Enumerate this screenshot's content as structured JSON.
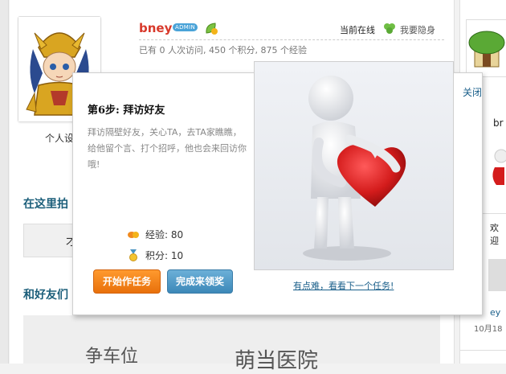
{
  "profile": {
    "username": "bney",
    "badge": "ADMIN",
    "avatar_label": "个人设",
    "online_label": "当前在线",
    "hide_link": "我要隐身",
    "stats": "已有 0 人次访问, 450 个积分, 875 个经验"
  },
  "sections": {
    "section1_title": "在这里拍",
    "section1_box_text": "才",
    "section2_title": "和好友们",
    "big_text_1": "争车位",
    "big_text_2": "萌当医院"
  },
  "right_panel": {
    "close": "关闭",
    "br_text": "br",
    "huan_text": "欢迎",
    "ey_text": "ey",
    "date_text": "10月18"
  },
  "popup": {
    "title": "第6步: 拜访好友",
    "description": "拜访隔壁好友，关心TA，去TA家瞧瞧，给他留个言、打个招呼，他也会来回访你哦!",
    "exp_label": "经验: 80",
    "points_label": "积分: 10",
    "start_button": "开始作任务",
    "finish_button": "完成来领奖",
    "close_link": "关闭",
    "next_link": "有点难，看看下一个任务!"
  },
  "colors": {
    "username": "#d8392b",
    "section_title": "#1b5e7a",
    "link": "#1a5f8a",
    "start_button": "#f08a1e",
    "finish_button": "#4a94c2",
    "heart": "#d41c1c"
  },
  "icons": [
    "leaf-icon",
    "clover-icon",
    "exp-icon",
    "medal-icon",
    "heart-figure-illustration",
    "saint-avatar"
  ]
}
